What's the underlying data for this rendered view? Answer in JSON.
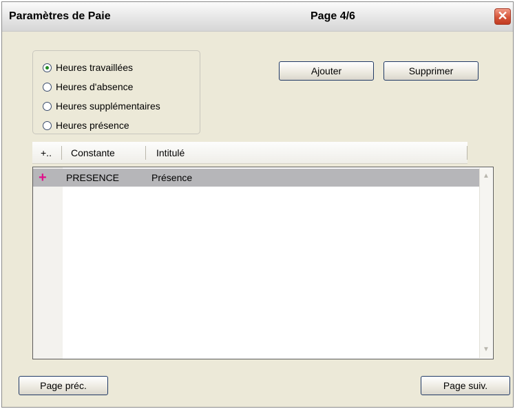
{
  "window": {
    "title": "Paramètres de Paie",
    "page_info": "Page 4/6",
    "close_glyph": "✕"
  },
  "options": {
    "items": [
      {
        "label": "Heures travaillées",
        "selected": true
      },
      {
        "label": "Heures d'absence",
        "selected": false
      },
      {
        "label": "Heures supplémentaires",
        "selected": false
      },
      {
        "label": "Heures présence",
        "selected": false
      }
    ]
  },
  "actions": {
    "add_label": "Ajouter",
    "delete_label": "Supprimer"
  },
  "table": {
    "columns": [
      "+..",
      "Constante",
      "Intitulé"
    ],
    "rows": [
      {
        "marker": "+",
        "constante": "PRESENCE",
        "intitule": "Présence",
        "selected": true
      }
    ]
  },
  "scrollbar": {
    "up": "▲",
    "down": "▼"
  },
  "navigation": {
    "prev_label": "Page préc.",
    "next_label": "Page suiv."
  },
  "colors": {
    "marker": "#e0108a",
    "selected_row": "#b6b6b9",
    "radio_dot": "#1f8a1f"
  }
}
